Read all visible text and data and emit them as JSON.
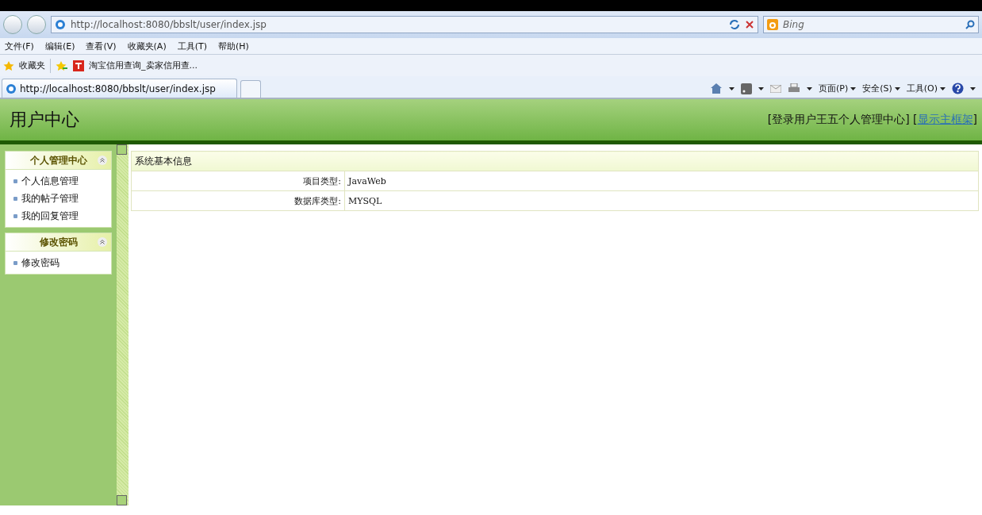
{
  "browser": {
    "address": "http://localhost:8080/bbslt/user/index.jsp",
    "search_placeholder": "Bing",
    "menu": [
      "文件(F)",
      "编辑(E)",
      "查看(V)",
      "收藏夹(A)",
      "工具(T)",
      "帮助(H)"
    ],
    "favorites_label": "收藏夹",
    "favorite_links": [
      "淘宝信用查询_卖家信用查..."
    ],
    "tabs": [
      {
        "title": "http://localhost:8080/bbslt/user/index.jsp",
        "selected": true
      }
    ],
    "commands": [
      "页面(P)",
      "安全(S)",
      "工具(O)"
    ]
  },
  "page": {
    "title": "用户中心",
    "user_info_prefix": "[登录用户王五个人管理中心] [",
    "user_info_link": "显示主框架",
    "user_info_suffix": "]",
    "sidebar": [
      {
        "title": "个人管理中心",
        "items": [
          "个人信息管理",
          "我的帖子管理",
          "我的回复管理"
        ]
      },
      {
        "title": "修改密码",
        "items": [
          "修改密码"
        ]
      }
    ],
    "table": {
      "title": "系统基本信息",
      "rows": [
        {
          "label": "项目类型:",
          "value": "JavaWeb"
        },
        {
          "label": "数据库类型:",
          "value": "MYSQL"
        }
      ]
    }
  }
}
